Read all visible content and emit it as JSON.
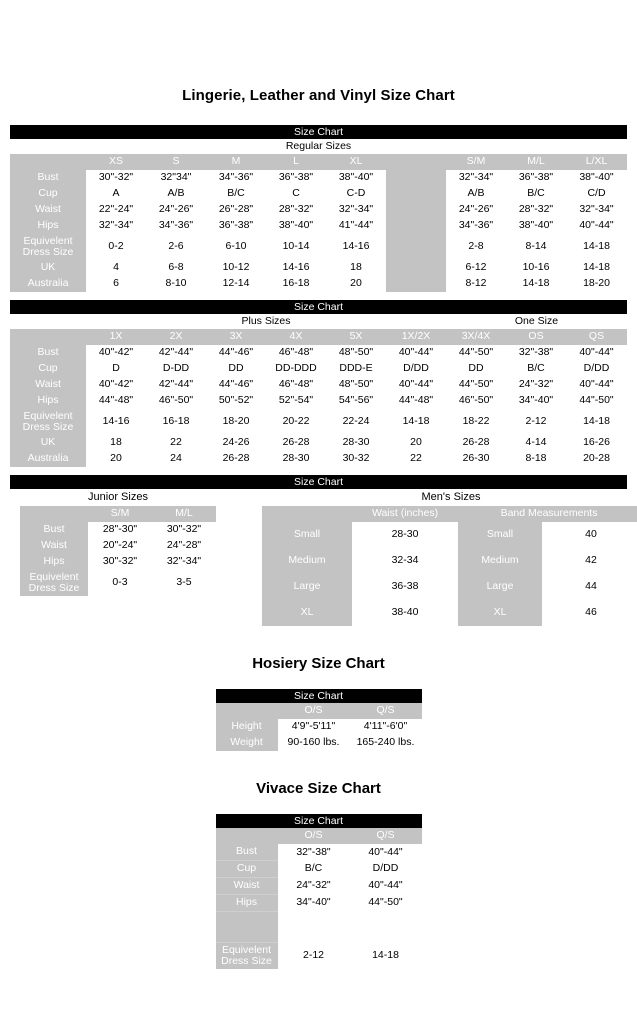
{
  "titles": {
    "main": "Lingerie, Leather and Vinyl Size Chart",
    "hosiery": "Hosiery Size Chart",
    "vivace": "Vivace Size Chart"
  },
  "common": {
    "size_chart_bar": "Size Chart"
  },
  "regular": {
    "caption": "Regular Sizes",
    "columns": [
      "XS",
      "S",
      "M",
      "L",
      "XL",
      "",
      "S/M",
      "M/L",
      "L/XL"
    ],
    "rows": [
      {
        "label": "Bust",
        "values": [
          "30\"-32\"",
          "32\"34\"",
          "34\"-36\"",
          "36\"-38\"",
          "38\"-40\"",
          "",
          "32\"-34\"",
          "36\"-38\"",
          "38\"-40\""
        ]
      },
      {
        "label": "Cup",
        "values": [
          "A",
          "A/B",
          "B/C",
          "C",
          "C-D",
          "",
          "A/B",
          "B/C",
          "C/D"
        ]
      },
      {
        "label": "Waist",
        "values": [
          "22\"-24\"",
          "24\"-26\"",
          "26\"-28\"",
          "28\"-32\"",
          "32\"-34\"",
          "",
          "24\"-26\"",
          "28\"-32\"",
          "32\"-34\""
        ]
      },
      {
        "label": "Hips",
        "values": [
          "32\"-34\"",
          "34\"-36\"",
          "36\"-38\"",
          "38\"-40\"",
          "41\"-44\"",
          "",
          "34\"-36\"",
          "38\"-40\"",
          "40\"-44\""
        ]
      },
      {
        "label": "Equivelent Dress Size",
        "values": [
          "0-2",
          "2-6",
          "6-10",
          "10-14",
          "14-16",
          "",
          "2-8",
          "8-14",
          "14-18"
        ],
        "tall": true
      },
      {
        "label": "UK",
        "values": [
          "4",
          "6-8",
          "10-12",
          "14-16",
          "18",
          "",
          "6-12",
          "10-16",
          "14-18"
        ]
      },
      {
        "label": "Australia",
        "values": [
          "6",
          "8-10",
          "12-14",
          "16-18",
          "20",
          "",
          "8-12",
          "14-18",
          "18-20"
        ]
      }
    ]
  },
  "plus": {
    "caption_left": "Plus Sizes",
    "caption_right": "One Size",
    "columns": [
      "1X",
      "2X",
      "3X",
      "4X",
      "5X",
      "1X/2X",
      "3X/4X",
      "OS",
      "QS"
    ],
    "rows": [
      {
        "label": "Bust",
        "values": [
          "40\"-42\"",
          "42\"-44\"",
          "44\"-46\"",
          "46\"-48\"",
          "48\"-50\"",
          "40\"-44\"",
          "44\"-50\"",
          "32\"-38\"",
          "40\"-44\""
        ]
      },
      {
        "label": "Cup",
        "values": [
          "D",
          "D-DD",
          "DD",
          "DD-DDD",
          "DDD-E",
          "D/DD",
          "DD",
          "B/C",
          "D/DD"
        ]
      },
      {
        "label": "Waist",
        "values": [
          "40\"-42\"",
          "42\"-44\"",
          "44\"-46\"",
          "46\"-48\"",
          "48\"-50\"",
          "40\"-44\"",
          "44\"-50\"",
          "24\"-32\"",
          "40\"-44\""
        ]
      },
      {
        "label": "Hips",
        "values": [
          "44\"-48\"",
          "46\"-50\"",
          "50\"-52\"",
          "52\"-54\"",
          "54\"-56\"",
          "44\"-48\"",
          "46\"-50\"",
          "34\"-40\"",
          "44\"-50\""
        ]
      },
      {
        "label": "Equivelent Dress Size",
        "values": [
          "14-16",
          "16-18",
          "18-20",
          "20-22",
          "22-24",
          "14-18",
          "18-22",
          "2-12",
          "14-18"
        ],
        "tall": true
      },
      {
        "label": "UK",
        "values": [
          "18",
          "22",
          "24-26",
          "26-28",
          "28-30",
          "20",
          "26-28",
          "4-14",
          "16-26"
        ]
      },
      {
        "label": "Australia",
        "values": [
          "20",
          "24",
          "26-28",
          "28-30",
          "30-32",
          "22",
          "26-30",
          "8-18",
          "20-28"
        ]
      }
    ]
  },
  "junior": {
    "caption": "Junior Sizes",
    "columns": [
      "S/M",
      "M/L"
    ],
    "rows": [
      {
        "label": "Bust",
        "values": [
          "28\"-30\"",
          "30\"-32\""
        ]
      },
      {
        "label": "Waist",
        "values": [
          "20\"-24\"",
          "24\"-28\""
        ]
      },
      {
        "label": "Hips",
        "values": [
          "30\"-32\"",
          "32\"-34\""
        ]
      },
      {
        "label": "Equivelent Dress Size",
        "values": [
          "0-3",
          "3-5"
        ],
        "tall": true
      }
    ]
  },
  "mens": {
    "caption": "Men's Sizes",
    "waist_header": "Waist (inches)",
    "band_header": "Band Measurements",
    "rows": [
      {
        "size": "Small",
        "waist": "28-30",
        "band_size": "Small",
        "band": "40"
      },
      {
        "size": "Medium",
        "waist": "32-34",
        "band_size": "Medium",
        "band": "42"
      },
      {
        "size": "Large",
        "waist": "36-38",
        "band_size": "Large",
        "band": "44"
      },
      {
        "size": "XL",
        "waist": "38-40",
        "band_size": "XL",
        "band": "46"
      }
    ]
  },
  "hosiery": {
    "columns": [
      "O/S",
      "Q/S"
    ],
    "rows": [
      {
        "label": "Height",
        "values": [
          "4'9\"-5'11\"",
          "4'11\"-6'0\""
        ]
      },
      {
        "label": "Weight",
        "values": [
          "90-160 lbs.",
          "165-240 lbs."
        ]
      }
    ]
  },
  "vivace": {
    "columns": [
      "O/S",
      "Q/S"
    ],
    "rows": [
      {
        "label": "Bust",
        "values": [
          "32\"-38\"",
          "40\"-44\""
        ]
      },
      {
        "label": "Cup",
        "values": [
          "B/C",
          "D/DD"
        ]
      },
      {
        "label": "Waist",
        "values": [
          "24\"-32\"",
          "40\"-44\""
        ]
      },
      {
        "label": "Hips",
        "values": [
          "34\"-40\"",
          "44\"-50\""
        ]
      },
      {
        "label": "",
        "values": [
          "",
          ""
        ],
        "gap": true
      },
      {
        "label": "Equivelent Dress Size",
        "values": [
          "2-12",
          "14-18"
        ],
        "tall": true
      }
    ]
  },
  "colors": {
    "header_gray": "#c3c3c3",
    "bar_black": "#000000",
    "text_white": "#ffffff",
    "text_black": "#000000"
  }
}
